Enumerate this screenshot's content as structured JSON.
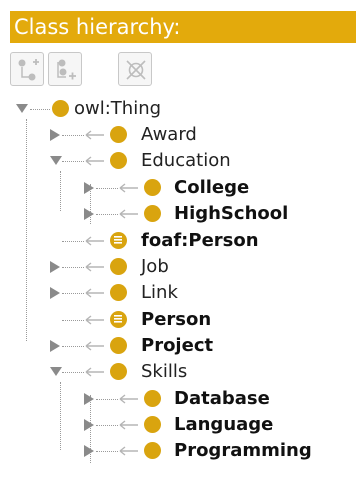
{
  "panel": {
    "title": "Class hierarchy:"
  },
  "toolbar": {
    "add_subclass_icon": "add-subclass-icon",
    "add_sibling_icon": "add-sibling-icon",
    "delete_icon": "delete-class-icon"
  },
  "colors": {
    "accent": "#e3aa0c",
    "class_icon": "#d9a40f",
    "tree_line": "#9a9a9a"
  },
  "tree": {
    "root": {
      "label": "owl:Thing",
      "expanded": true
    },
    "children": [
      {
        "label": "Award",
        "bold": false,
        "toggle": "collapsed",
        "icon": "class-icon"
      },
      {
        "label": "Education",
        "bold": false,
        "toggle": "expanded",
        "icon": "class-icon",
        "children": [
          {
            "label": "College",
            "bold": true,
            "toggle": "collapsed",
            "icon": "class-icon"
          },
          {
            "label": "HighSchool",
            "bold": true,
            "toggle": "collapsed",
            "icon": "class-icon"
          }
        ]
      },
      {
        "label": "foaf:Person",
        "bold": true,
        "toggle": "none",
        "icon": "defined-class-icon"
      },
      {
        "label": "Job",
        "bold": false,
        "toggle": "collapsed",
        "icon": "class-icon"
      },
      {
        "label": "Link",
        "bold": false,
        "toggle": "collapsed",
        "icon": "class-icon"
      },
      {
        "label": "Person",
        "bold": true,
        "toggle": "none",
        "icon": "defined-class-icon"
      },
      {
        "label": "Project",
        "bold": true,
        "toggle": "collapsed",
        "icon": "class-icon"
      },
      {
        "label": "Skills",
        "bold": false,
        "toggle": "expanded",
        "icon": "class-icon",
        "children": [
          {
            "label": "Database",
            "bold": true,
            "toggle": "collapsed",
            "icon": "class-icon"
          },
          {
            "label": "Language",
            "bold": true,
            "toggle": "collapsed",
            "icon": "class-icon"
          },
          {
            "label": "Programming",
            "bold": true,
            "toggle": "collapsed",
            "icon": "class-icon"
          }
        ]
      }
    ]
  }
}
